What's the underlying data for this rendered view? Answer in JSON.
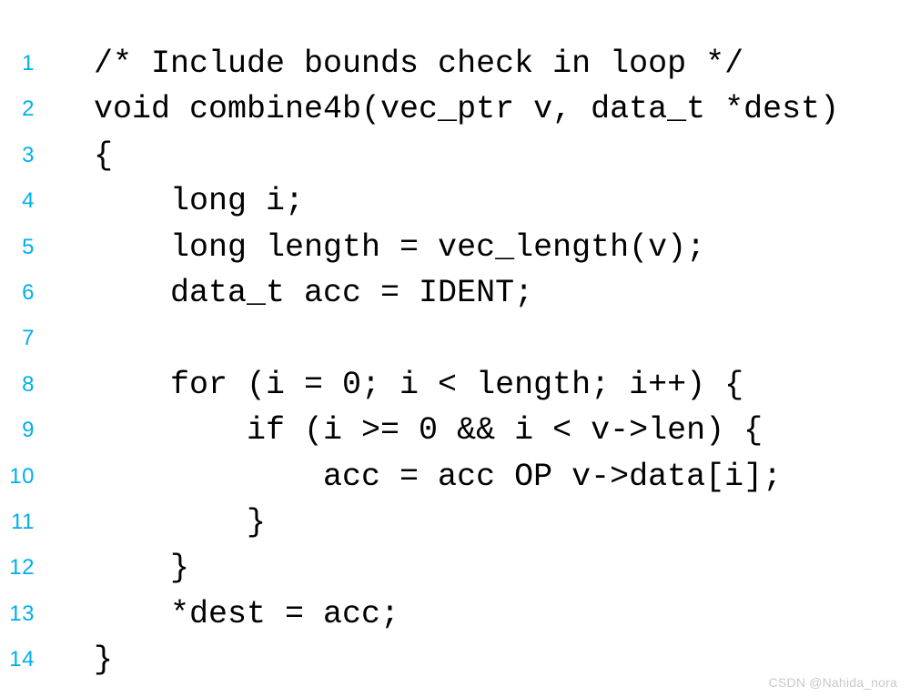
{
  "document": {
    "type": "code-listing",
    "language": "c",
    "background_color": "#ffffff",
    "line_number_color": "#00aeef",
    "code_color": "#000000",
    "total_lines": 14
  },
  "lines": [
    {
      "number": "1",
      "code": "/* Include bounds check in loop */"
    },
    {
      "number": "2",
      "code": "void combine4b(vec_ptr v, data_t *dest)"
    },
    {
      "number": "3",
      "code": "{"
    },
    {
      "number": "4",
      "code": "    long i;"
    },
    {
      "number": "5",
      "code": "    long length = vec_length(v);"
    },
    {
      "number": "6",
      "code": "    data_t acc = IDENT;"
    },
    {
      "number": "7",
      "code": ""
    },
    {
      "number": "8",
      "code": "    for (i = 0; i < length; i++) {"
    },
    {
      "number": "9",
      "code": "        if (i >= 0 && i < v->len) {"
    },
    {
      "number": "10",
      "code": "            acc = acc OP v->data[i];"
    },
    {
      "number": "11",
      "code": "        }"
    },
    {
      "number": "12",
      "code": "    }"
    },
    {
      "number": "13",
      "code": "    *dest = acc;"
    },
    {
      "number": "14",
      "code": "}"
    }
  ],
  "watermark": {
    "text": "CSDN @Nahida_nora",
    "color": "#c9c9c9"
  }
}
